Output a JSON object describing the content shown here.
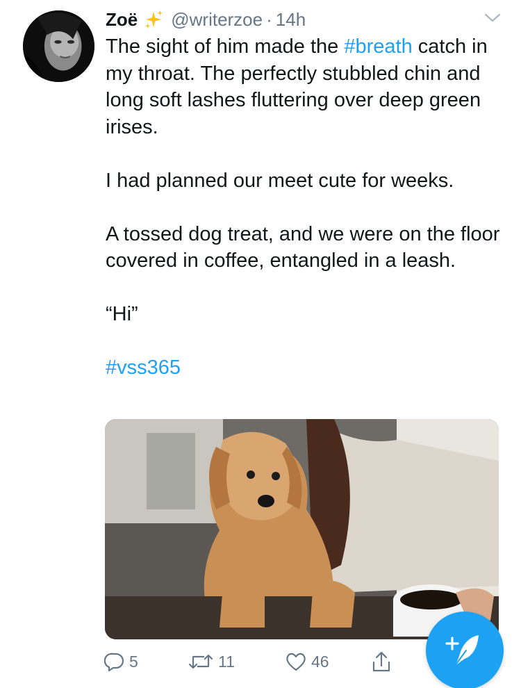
{
  "tweet": {
    "author_name": "Zoë",
    "author_handle": "@writerzoe",
    "separator": "·",
    "timestamp": "14h",
    "paragraphs": [
      {
        "before": "The sight of him made the ",
        "hashtag": "#breath",
        "after": " catch in my throat. The perfectly stubbled chin and long soft lashes fluttering over deep green irises."
      },
      {
        "text": "I had planned our meet cute for weeks."
      },
      {
        "text": "A tossed dog treat, and we were on the floor covered in coffee, entangled in a leash."
      },
      {
        "text": "“Hi”"
      }
    ],
    "hashtag_line": "#vss365"
  },
  "actions": {
    "reply_count": "5",
    "retweet_count": "11",
    "like_count": "46"
  },
  "icons": {
    "name_emoji": "sparkles-icon",
    "menu": "chevron-down-icon",
    "reply": "reply-icon",
    "retweet": "retweet-icon",
    "like": "heart-icon",
    "share": "share-icon",
    "compose": "compose-tweet-icon"
  },
  "colors": {
    "link": "#1da1f2",
    "text": "#14171a",
    "secondary": "#657786",
    "fab": "#1da1f2",
    "sparkle": "#fcc21b"
  }
}
